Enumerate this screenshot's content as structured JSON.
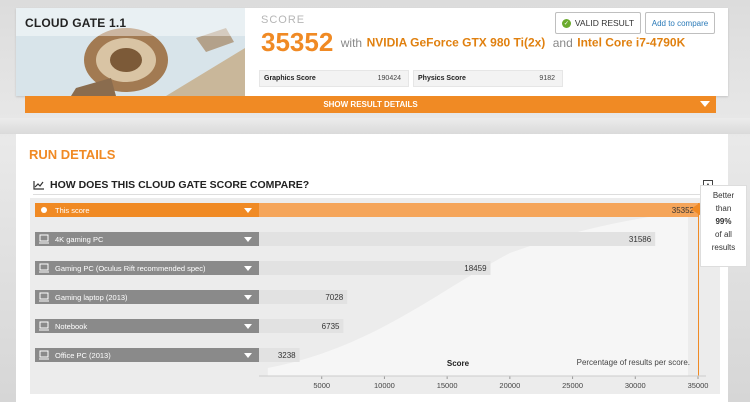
{
  "benchmark": {
    "title": "CLOUD GATE 1.1"
  },
  "score": {
    "caption": "SCORE",
    "value": "35352",
    "with_text": "with",
    "gpu": "NVIDIA GeForce GTX 980 Ti(2x)",
    "and_text": "and",
    "cpu": "Intel Core i7-4790K"
  },
  "sub_scores": [
    {
      "label": "Graphics Score",
      "value": "190424"
    },
    {
      "label": "Physics Score",
      "value": "9182"
    }
  ],
  "buttons": {
    "valid": "VALID RESULT",
    "compare": "Add to compare",
    "show_details": "SHOW RESULT DETAILS"
  },
  "run_details": {
    "title": "RUN DETAILS",
    "compare_title": "HOW DOES THIS CLOUD GATE SCORE COMPARE?"
  },
  "callout": {
    "line1": "Better",
    "line2": "than",
    "pct": "99%",
    "line4": "of all",
    "line5": "results"
  },
  "colors": {
    "accent": "#f08a24",
    "bar_gray": "#e2e2e2",
    "label_gray": "#8a8a8a"
  },
  "chart_data": {
    "type": "bar",
    "orientation": "horizontal",
    "categories": [
      "This score",
      "4K gaming PC",
      "Gaming PC (Oculus Rift recommended spec)",
      "Gaming laptop (2013)",
      "Notebook",
      "Office PC (2013)"
    ],
    "values": [
      35352,
      31586,
      18459,
      7028,
      6735,
      3238
    ],
    "value_labels": [
      "35352",
      "31586",
      "18459",
      "7028",
      "6735",
      "3238"
    ],
    "highlight_index": 0,
    "xlabel": "Score",
    "annotation": "Percentage of results per score.",
    "x_ticks": [
      "5000",
      "10000",
      "15000",
      "20000",
      "25000",
      "30000",
      "35000"
    ],
    "x_tick_values": [
      5000,
      10000,
      15000,
      20000,
      25000,
      30000,
      35000
    ],
    "xlim": [
      0,
      35000
    ]
  }
}
